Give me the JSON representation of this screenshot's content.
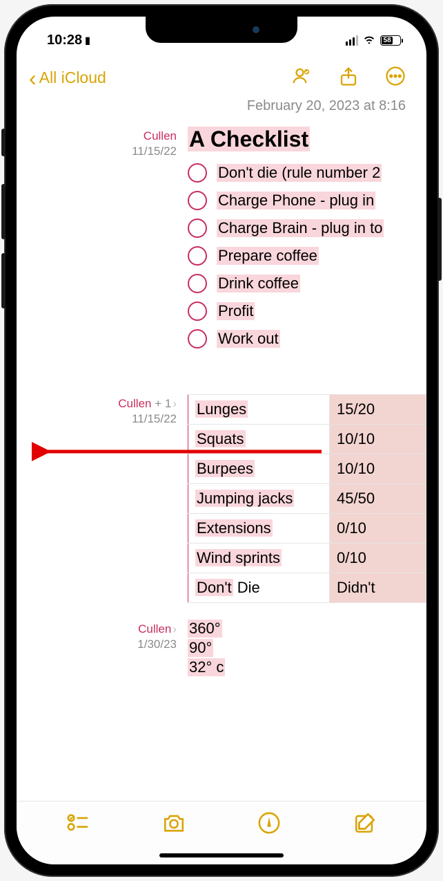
{
  "status": {
    "time": "10:28",
    "battery_pct": "58"
  },
  "nav": {
    "back_label": "All iCloud"
  },
  "timestamp": "February 20, 2023 at 8:16",
  "block1": {
    "author": "Cullen",
    "date": "11/15/22",
    "title": "A Checklist",
    "items": [
      "Don't die (rule number 2",
      "Charge Phone - plug in ",
      "Charge Brain - plug in to",
      "Prepare coffee",
      "Drink coffee",
      "Profit",
      "Work out"
    ]
  },
  "block2": {
    "author": "Cullen",
    "author_suffix": " + 1",
    "date": "11/15/22",
    "rows": [
      {
        "name": "Lunges",
        "val": "15/20"
      },
      {
        "name": "Squats",
        "val": "10/10"
      },
      {
        "name": "Burpees",
        "val": "10/10"
      },
      {
        "name": "Jumping jacks",
        "val": "45/50"
      },
      {
        "name": "Extensions",
        "val": "0/10"
      },
      {
        "name": "Wind sprints",
        "val": "0/10"
      },
      {
        "name_pre": "Don't",
        "name_post": " Die",
        "val": "Didn't"
      }
    ]
  },
  "block3": {
    "author": "Cullen",
    "date": "1/30/23",
    "lines": [
      "360°",
      "90°",
      "32° c"
    ]
  }
}
